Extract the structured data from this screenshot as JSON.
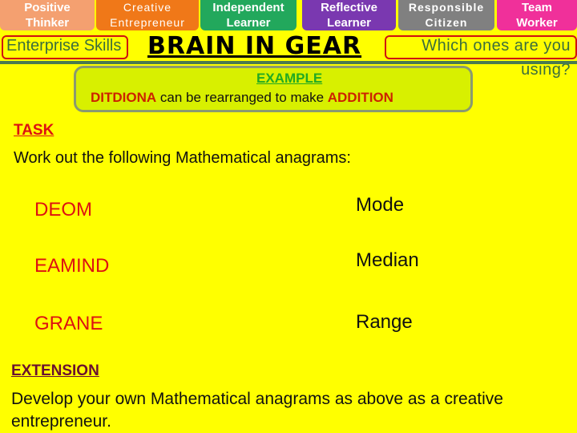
{
  "skills": [
    {
      "line1": "Positive",
      "line2": "Thinker",
      "color": "#f4a070"
    },
    {
      "line1": "Creative",
      "line2": "Entrepreneur",
      "color": "#f07818"
    },
    {
      "line1": "Independent",
      "line2": "Learner",
      "color": "#22a85c"
    },
    {
      "line1": "Reflective",
      "line2": "Learner",
      "color": "#7a38b0"
    },
    {
      "line1": "Responsible",
      "line2": "Citizen",
      "color": "#808080"
    },
    {
      "line1": "Team",
      "line2": "Worker",
      "color": "#f0309a"
    }
  ],
  "header": {
    "enterprise_label": "Enterprise Skills",
    "title": "BRAIN IN GEAR",
    "question_line1": "Which ones are you",
    "question_line2": "using?"
  },
  "example": {
    "title": "EXAMPLE",
    "scrambled": "DITDIONA",
    "middle": " can be rearranged to make ",
    "answer": "ADDITION"
  },
  "task": {
    "title": "TASK",
    "description": "Work out the following Mathematical anagrams:",
    "items": [
      {
        "anagram": "DEOM",
        "answer": "Mode"
      },
      {
        "anagram": "EAMIND",
        "answer": "Median"
      },
      {
        "anagram": "GRANE",
        "answer": "Range"
      }
    ]
  },
  "extension": {
    "title": "EXTENSION",
    "description": "Develop your own Mathematical anagrams as above as a creative entrepreneur."
  },
  "colors": {
    "background": "#ffff00",
    "accent_red": "#dd1111",
    "label_green": "#3c6e3c"
  }
}
